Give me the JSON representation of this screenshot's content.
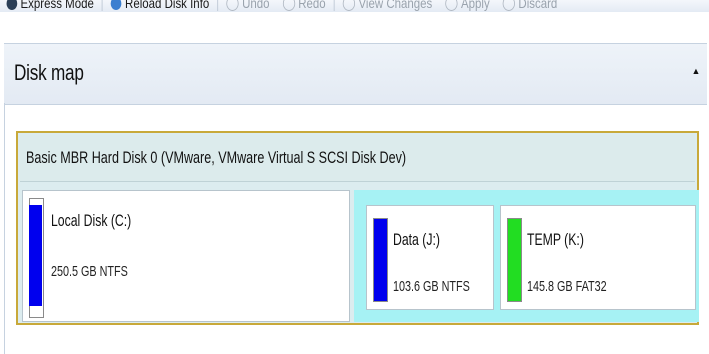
{
  "toolbar": {
    "items": [
      {
        "label": "Express Mode",
        "icon": "express-mode-icon",
        "enabled": true
      },
      {
        "label": "Reload Disk Info",
        "icon": "reload-icon",
        "enabled": true
      },
      {
        "label": "Undo",
        "icon": "undo-icon",
        "enabled": false
      },
      {
        "label": "Redo",
        "icon": "redo-icon",
        "enabled": false
      },
      {
        "label": "View Changes",
        "icon": "view-changes-icon",
        "enabled": false
      },
      {
        "label": "Apply",
        "icon": "apply-icon",
        "enabled": false
      },
      {
        "label": "Discard",
        "icon": "discard-icon",
        "enabled": false
      }
    ]
  },
  "panel": {
    "title": "Disk map",
    "collapse_glyph": "▲"
  },
  "disk": {
    "title": "Basic MBR Hard Disk 0 (VMware, VMware Virtual S SCSI Disk Dev)",
    "partitions": [
      {
        "name": "Local Disk (C:)",
        "size": "250.5 GB NTFS",
        "color": "#0000ee",
        "fill_fraction": 0.7
      },
      {
        "name": "Data (J:)",
        "size": "103.6 GB NTFS",
        "color": "#0000ee",
        "fill_fraction": 0.9
      },
      {
        "name": "TEMP (K:)",
        "size": "145.8 GB FAT32",
        "color": "#22dd22",
        "fill_fraction": 0.9
      }
    ]
  },
  "colors": {
    "disk_border": "#c8a93a",
    "extended_partition": "#a6f2f4"
  }
}
